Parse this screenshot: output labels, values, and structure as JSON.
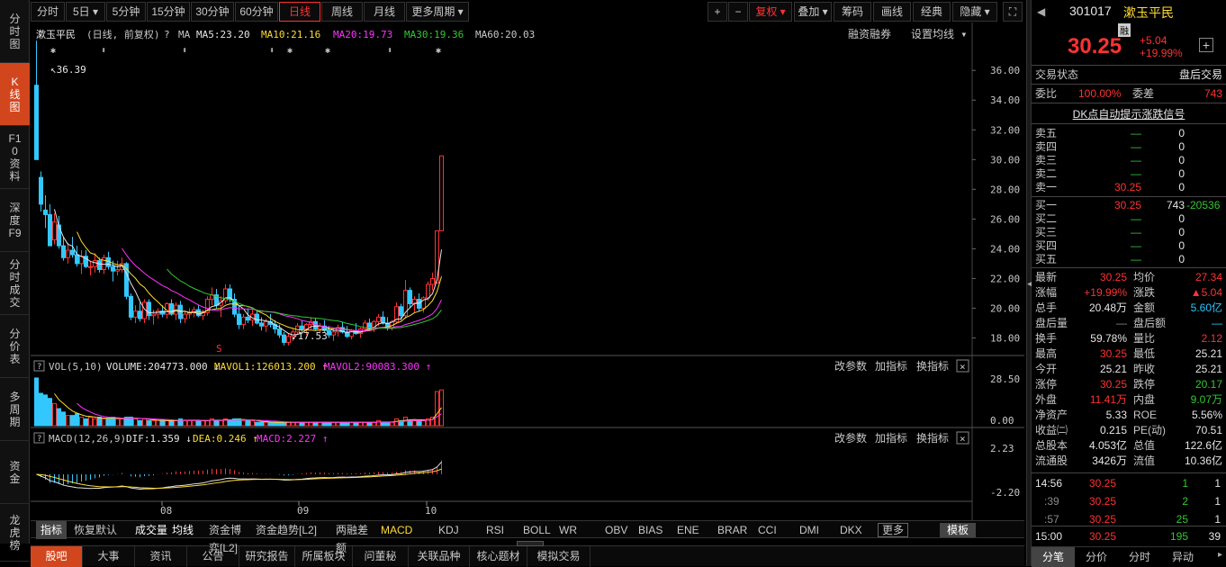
{
  "left_nav": [
    "分时图",
    "K线图",
    "F10资料",
    "深度F9",
    "分时成交",
    "分价表",
    "多周期",
    "资金",
    "龙虎榜"
  ],
  "period_tabs": [
    "分时",
    "5日",
    "5分钟",
    "15分钟",
    "30分钟",
    "60分钟",
    "日线",
    "周线",
    "月线",
    "更多周期"
  ],
  "right_tools": [
    "复权",
    "叠加",
    "筹码",
    "画线",
    "经典",
    "隐藏"
  ],
  "chart_header": {
    "name": "漱玉平民",
    "mode": "(日线, 前复权)",
    "ma5": "MA5:23.20",
    "ma10": "MA10:21.16",
    "ma20": "MA20:19.73",
    "ma30": "MA30:19.36",
    "ma60": "MA60:20.03",
    "rzrq": "融资融券",
    "setma": "设置均线"
  },
  "vol_header": {
    "name": "VOL(5,10)",
    "volume": "VOLUME:204773.000",
    "mavol1": "MAVOL1:126013.200",
    "mavol2": "MAVOL2:90083.300"
  },
  "macd_header": {
    "name": "MACD(12,26,9)",
    "dif": "DIF:1.359",
    "dea": "DEA:0.246",
    "macd": "MACD:2.227"
  },
  "panel_buttons": [
    "改参数",
    "加指标",
    "换指标"
  ],
  "annotations": {
    "high": "36.39",
    "low": "17.53"
  },
  "price_axis": [
    "36.00",
    "34.00",
    "32.00",
    "30.00",
    "28.00",
    "26.00",
    "24.00",
    "22.00",
    "20.00",
    "18.00"
  ],
  "vol_axis": [
    "28.50",
    "0.00"
  ],
  "macd_axis": [
    "2.23",
    "-2.20"
  ],
  "month_labels": [
    "08",
    "09",
    "10"
  ],
  "indicator_tabs": [
    "指标",
    "恢复默认",
    "成交量",
    "均线",
    "资金博弈[L2]",
    "资金趋势[L2]",
    "两融差额",
    "MACD",
    "KDJ",
    "RSI",
    "BOLL",
    "WR",
    "OBV",
    "BIAS",
    "ENE",
    "BRAR",
    "CCI",
    "DMI",
    "DKX",
    "更多",
    "模板"
  ],
  "bottom_tabs": [
    "股吧",
    "大事",
    "资讯",
    "公告",
    "研究报告",
    "所属板块",
    "问董秘",
    "关联品种",
    "核心题材",
    "模拟交易"
  ],
  "quote": {
    "code": "301017",
    "name": "漱玉平民",
    "tag": "融",
    "price": "30.25",
    "change": "+5.04",
    "pct": "+19.99%",
    "status_label": "交易状态",
    "status": "盘后交易",
    "wb_label": "委比",
    "wb": "100.00%",
    "wc_label": "委差",
    "wc": "743",
    "dk": "DK点自动提示涨跌信号",
    "sell": [
      {
        "l": "卖五",
        "p": "—",
        "v": "0"
      },
      {
        "l": "卖四",
        "p": "—",
        "v": "0"
      },
      {
        "l": "卖三",
        "p": "—",
        "v": "0"
      },
      {
        "l": "卖二",
        "p": "—",
        "v": "0"
      },
      {
        "l": "卖一",
        "p": "30.25",
        "v": "0"
      }
    ],
    "buy": [
      {
        "l": "买一",
        "p": "30.25",
        "v": "743",
        "e": "-20536"
      },
      {
        "l": "买二",
        "p": "—",
        "v": "0",
        "e": ""
      },
      {
        "l": "买三",
        "p": "—",
        "v": "0",
        "e": ""
      },
      {
        "l": "买四",
        "p": "—",
        "v": "0",
        "e": ""
      },
      {
        "l": "买五",
        "p": "—",
        "v": "0",
        "e": ""
      }
    ],
    "stats": [
      [
        "最新",
        "30.25",
        "均价",
        "27.34"
      ],
      [
        "涨幅",
        "+19.99%",
        "涨跌",
        "▲5.04"
      ],
      [
        "总手",
        "20.48万",
        "金额",
        "5.60亿"
      ],
      [
        "盘后量",
        "—",
        "盘后额",
        "—"
      ],
      [
        "换手",
        "59.78%",
        "量比",
        "2.12"
      ],
      [
        "最高",
        "30.25",
        "最低",
        "25.21"
      ],
      [
        "今开",
        "25.21",
        "昨收",
        "25.21"
      ],
      [
        "涨停",
        "30.25",
        "跌停",
        "20.17"
      ],
      [
        "外盘",
        "11.41万",
        "内盘",
        "9.07万"
      ],
      [
        "净资产",
        "5.33",
        "ROE",
        "5.56%"
      ],
      [
        "收益㈡",
        "0.215",
        "PE(动)",
        "70.51"
      ],
      [
        "总股本",
        "4.053亿",
        "总值",
        "122.6亿"
      ],
      [
        "流通股",
        "3426万",
        "流值",
        "10.36亿"
      ]
    ],
    "ticks": [
      [
        "14:56",
        "30.25",
        "1",
        "1"
      ],
      [
        ":39",
        "30.25",
        "2",
        "1"
      ],
      [
        ":57",
        "30.25",
        "25",
        "1"
      ],
      [
        "15:00",
        "30.25",
        "195",
        "39"
      ]
    ],
    "tabs": [
      "分笔",
      "分价",
      "分时",
      "异动"
    ]
  },
  "chart_data": {
    "type": "candlestick",
    "ylim": [
      17,
      36.8
    ],
    "candles": [
      [
        35.0,
        38.0,
        30.0,
        30.0
      ],
      [
        28.8,
        29.2,
        26.5,
        27.0
      ],
      [
        26.6,
        27.6,
        25.4,
        26.3
      ],
      [
        26.3,
        27.0,
        24.2,
        24.2
      ],
      [
        24.6,
        26.4,
        24.3,
        25.8
      ],
      [
        25.6,
        26.2,
        24.0,
        24.2
      ],
      [
        24.2,
        24.8,
        23.2,
        23.4
      ],
      [
        23.4,
        24.4,
        23.0,
        23.9
      ],
      [
        23.9,
        24.8,
        23.4,
        23.6
      ],
      [
        23.6,
        24.2,
        22.8,
        23.0
      ],
      [
        23.0,
        23.9,
        22.3,
        23.5
      ],
      [
        23.5,
        23.9,
        22.7,
        22.8
      ],
      [
        22.8,
        23.2,
        22.2,
        22.8
      ],
      [
        22.8,
        23.7,
        22.4,
        23.2
      ],
      [
        23.2,
        23.4,
        22.4,
        22.6
      ],
      [
        22.6,
        23.6,
        22.3,
        23.4
      ],
      [
        23.4,
        23.8,
        22.6,
        22.8
      ],
      [
        22.8,
        23.2,
        21.8,
        22.5
      ],
      [
        22.5,
        23.2,
        22.2,
        22.6
      ],
      [
        22.6,
        23.4,
        22.4,
        23.0
      ],
      [
        23.0,
        23.1,
        20.6,
        20.8
      ],
      [
        20.8,
        21.0,
        19.2,
        19.4
      ],
      [
        19.4,
        20.2,
        19.0,
        19.8
      ],
      [
        19.8,
        20.4,
        19.1,
        19.3
      ],
      [
        19.3,
        20.6,
        19.0,
        20.4
      ],
      [
        20.4,
        20.6,
        19.2,
        19.5
      ],
      [
        19.5,
        19.9,
        18.9,
        19.6
      ],
      [
        19.6,
        20.0,
        19.3,
        19.8
      ],
      [
        19.8,
        20.2,
        19.4,
        19.6
      ],
      [
        19.6,
        20.4,
        19.3,
        20.3
      ],
      [
        20.3,
        20.6,
        19.5,
        19.6
      ],
      [
        19.6,
        20.4,
        19.2,
        20.2
      ],
      [
        20.2,
        20.5,
        19.0,
        19.3
      ],
      [
        19.3,
        19.8,
        19.0,
        19.6
      ],
      [
        19.6,
        20.0,
        19.3,
        19.7
      ],
      [
        19.7,
        20.1,
        19.4,
        19.9
      ],
      [
        19.9,
        20.2,
        19.4,
        19.5
      ],
      [
        19.5,
        19.9,
        19.2,
        19.7
      ],
      [
        19.7,
        20.8,
        19.5,
        20.6
      ],
      [
        20.6,
        21.4,
        20.2,
        20.9
      ],
      [
        20.9,
        21.3,
        20.0,
        20.2
      ],
      [
        20.2,
        20.8,
        19.4,
        20.5
      ],
      [
        20.5,
        21.6,
        20.3,
        21.3
      ],
      [
        21.3,
        21.6,
        20.4,
        20.6
      ],
      [
        20.6,
        21.0,
        19.4,
        19.6
      ],
      [
        19.6,
        20.2,
        18.6,
        18.9
      ],
      [
        18.9,
        19.6,
        18.6,
        19.4
      ],
      [
        19.4,
        20.0,
        19.0,
        19.2
      ],
      [
        19.2,
        19.9,
        18.8,
        19.6
      ],
      [
        19.6,
        19.8,
        18.9,
        19.0
      ],
      [
        19.0,
        19.4,
        18.5,
        18.8
      ],
      [
        18.8,
        19.3,
        18.4,
        19.1
      ],
      [
        19.1,
        19.6,
        18.7,
        18.9
      ],
      [
        18.9,
        19.2,
        18.3,
        18.6
      ],
      [
        18.6,
        18.9,
        18.0,
        18.2
      ],
      [
        18.2,
        18.4,
        17.5,
        17.7
      ],
      [
        17.7,
        18.3,
        17.5,
        18.1
      ],
      [
        18.1,
        18.6,
        17.8,
        18.4
      ],
      [
        18.4,
        19.0,
        18.2,
        18.8
      ],
      [
        18.8,
        19.2,
        18.4,
        18.6
      ],
      [
        18.6,
        19.0,
        18.2,
        18.9
      ],
      [
        18.9,
        19.4,
        18.6,
        19.1
      ],
      [
        19.1,
        19.3,
        18.5,
        18.6
      ],
      [
        18.6,
        19.0,
        18.3,
        18.8
      ],
      [
        18.8,
        19.2,
        18.4,
        18.5
      ],
      [
        18.5,
        18.8,
        18.0,
        18.2
      ],
      [
        18.2,
        18.6,
        17.8,
        18.4
      ],
      [
        18.4,
        18.9,
        18.1,
        18.7
      ],
      [
        18.7,
        19.1,
        18.3,
        18.4
      ],
      [
        18.4,
        18.8,
        18.0,
        18.1
      ],
      [
        18.1,
        18.6,
        17.9,
        18.5
      ],
      [
        18.5,
        19.0,
        18.2,
        18.3
      ],
      [
        18.3,
        18.7,
        18.0,
        18.6
      ],
      [
        18.6,
        19.2,
        18.4,
        19.0
      ],
      [
        19.0,
        19.3,
        18.5,
        18.6
      ],
      [
        18.6,
        19.2,
        18.4,
        19.1
      ],
      [
        19.1,
        19.6,
        18.8,
        19.4
      ],
      [
        19.4,
        19.8,
        18.9,
        19.0
      ],
      [
        19.0,
        19.4,
        18.5,
        18.7
      ],
      [
        18.7,
        19.2,
        18.5,
        19.1
      ],
      [
        19.1,
        20.4,
        19.0,
        20.1
      ],
      [
        20.1,
        20.3,
        19.2,
        19.5
      ],
      [
        19.5,
        21.9,
        19.3,
        21.2
      ],
      [
        21.2,
        21.4,
        20.0,
        20.3
      ],
      [
        20.3,
        20.8,
        19.7,
        20.6
      ],
      [
        20.6,
        21.0,
        19.8,
        20.0
      ],
      [
        20.0,
        20.8,
        19.7,
        20.7
      ],
      [
        20.7,
        21.8,
        20.5,
        21.6
      ],
      [
        21.6,
        22.4,
        21.2,
        22.0
      ],
      [
        21.7,
        25.2,
        21.7,
        25.2
      ],
      [
        25.21,
        30.25,
        25.21,
        30.25
      ]
    ],
    "volumes": [
      28,
      19,
      18,
      16,
      13,
      10,
      8,
      6,
      6,
      7,
      5,
      4,
      5,
      4,
      5,
      4,
      4,
      5,
      4,
      4,
      5,
      5,
      4,
      3,
      4,
      3,
      3,
      3,
      3,
      3,
      3,
      3,
      4,
      3,
      3,
      3,
      3,
      3,
      3,
      4,
      3,
      3,
      4,
      3,
      4,
      4,
      3,
      3,
      3,
      2,
      2,
      2,
      2,
      2,
      2,
      2,
      2,
      2,
      2,
      2,
      2,
      2,
      2,
      2,
      2,
      2,
      2,
      2,
      2,
      2,
      2,
      2,
      2,
      2,
      2,
      2,
      3,
      2,
      2,
      2,
      4,
      3,
      5,
      3,
      3,
      3,
      3,
      4,
      5,
      20,
      21
    ]
  }
}
